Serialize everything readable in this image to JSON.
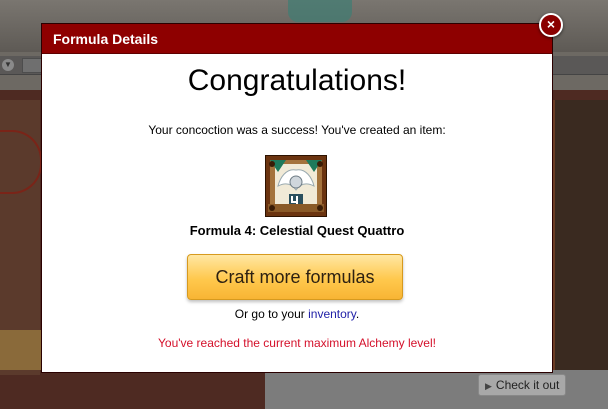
{
  "dialog": {
    "title": "Formula Details",
    "close_label": "×",
    "headline": "Congratulations!",
    "message": "Your concoction was a success! You've created an item:",
    "item_name": "Formula 4: Celestial Quest Quattro",
    "item_icon": "formula-scroll-icon",
    "craft_button_label": "Craft more formulas",
    "goto_prefix": "Or go to your",
    "goto_link": "inventory",
    "goto_suffix": ".",
    "status_message": "You've reached the current maximum Alchemy level!"
  },
  "background": {
    "check_it_out_label": "Check it out"
  },
  "colors": {
    "header": "#8e0000",
    "button": "#ffc84d",
    "link": "#2121a8",
    "warning": "#d4102a"
  }
}
